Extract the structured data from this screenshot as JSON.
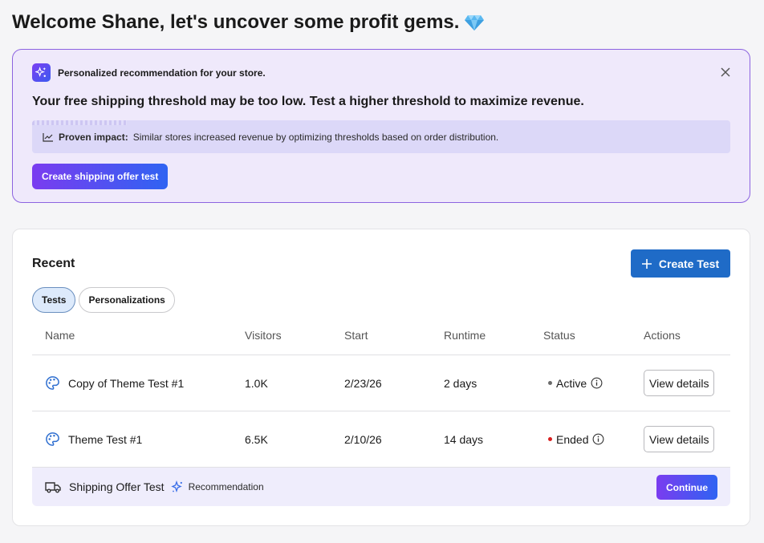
{
  "header": {
    "title": "Welcome Shane, let's uncover some profit gems.",
    "title_icon": "gem-icon"
  },
  "recommendation": {
    "label": "Personalized recommendation for your store.",
    "headline": "Your free shipping threshold may be too low. Test a higher threshold to maximize revenue.",
    "impact_label": "Proven impact:",
    "impact_text": "Similar stores increased revenue by optimizing thresholds based on order distribution.",
    "cta_label": "Create shipping offer test",
    "icons": [
      "sparkles-icon",
      "close-icon",
      "trend-chart-icon"
    ]
  },
  "recent": {
    "title": "Recent",
    "create_label": "Create Test",
    "tabs": [
      {
        "label": "Tests",
        "active": true
      },
      {
        "label": "Personalizations",
        "active": false
      }
    ],
    "columns": [
      "Name",
      "Visitors",
      "Start",
      "Runtime",
      "Status",
      "Actions"
    ],
    "rows": [
      {
        "name": "Copy of Theme Test #1",
        "visitors": "1.0K",
        "start": "2/23/26",
        "runtime": "2 days",
        "status": "Active",
        "status_color": "#6b6b6b",
        "action": "View details",
        "icon": "palette-icon"
      },
      {
        "name": "Theme Test #1",
        "visitors": "6.5K",
        "start": "2/10/26",
        "runtime": "14 days",
        "status": "Ended",
        "status_color": "#d91f1f",
        "action": "View details",
        "icon": "palette-icon"
      }
    ],
    "recommendation_row": {
      "name": "Shipping Offer Test",
      "tag": "Recommendation",
      "action": "Continue",
      "icon": "truck-icon"
    }
  },
  "colors": {
    "accent_purple": "#7a3cf0",
    "accent_blue": "#1f6bc7",
    "rec_bg": "#efe9fb"
  }
}
